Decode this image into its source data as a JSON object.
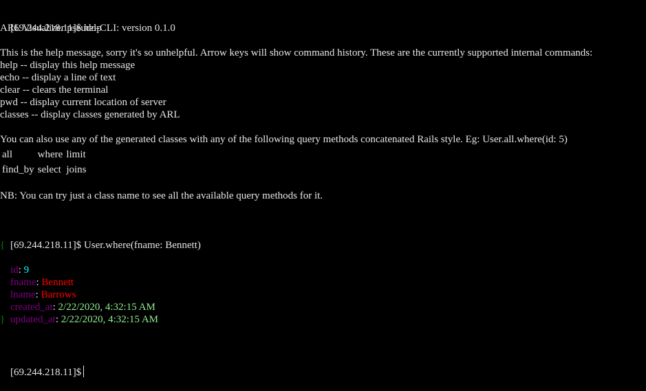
{
  "prompt": "[69.244.218.11]$",
  "session1": {
    "command": "help",
    "version_line": "ARL Visualizer pseudo-CLI: version 0.1.0",
    "intro": "This is the help message, sorry it's so unhelpful. Arrow keys will show command history. These are the currently supported internal commands:",
    "commands": [
      "help -- display this help message",
      "echo -- display a line of text",
      "clear -- clears the terminal",
      "pwd -- display current location of server",
      "classes -- display classes generated by ARL"
    ],
    "query_intro": "You can also use any of the generated classes with any of the following query methods concatenated Rails style. Eg: User.all.where(id: 5)",
    "query_methods": [
      [
        "all",
        "where",
        "limit"
      ],
      [
        "find_by",
        "select",
        "joins"
      ]
    ],
    "nb": "NB: You can try just a class name to see all the available query methods for it."
  },
  "session2": {
    "command": "User.where(fname: Bennett)",
    "open_brace": "{",
    "close_brace": "}",
    "fields": [
      {
        "key": "id",
        "value": "9",
        "type": "number"
      },
      {
        "key": "fname",
        "value": "Bennett",
        "type": "string"
      },
      {
        "key": "lname",
        "value": "Barrows",
        "type": "string"
      },
      {
        "key": "created_at",
        "value": "2/22/2020, 4:32:15 AM",
        "type": "date"
      },
      {
        "key": "updated_at",
        "value": "2/22/2020, 4:32:15 AM",
        "type": "date"
      }
    ]
  },
  "colors": {
    "background": "#000000",
    "text": "#e6e6e6",
    "key": "#800080",
    "brace": "#008000",
    "number": "#00ffff",
    "string": "#ff0000",
    "date": "#90ee90"
  }
}
